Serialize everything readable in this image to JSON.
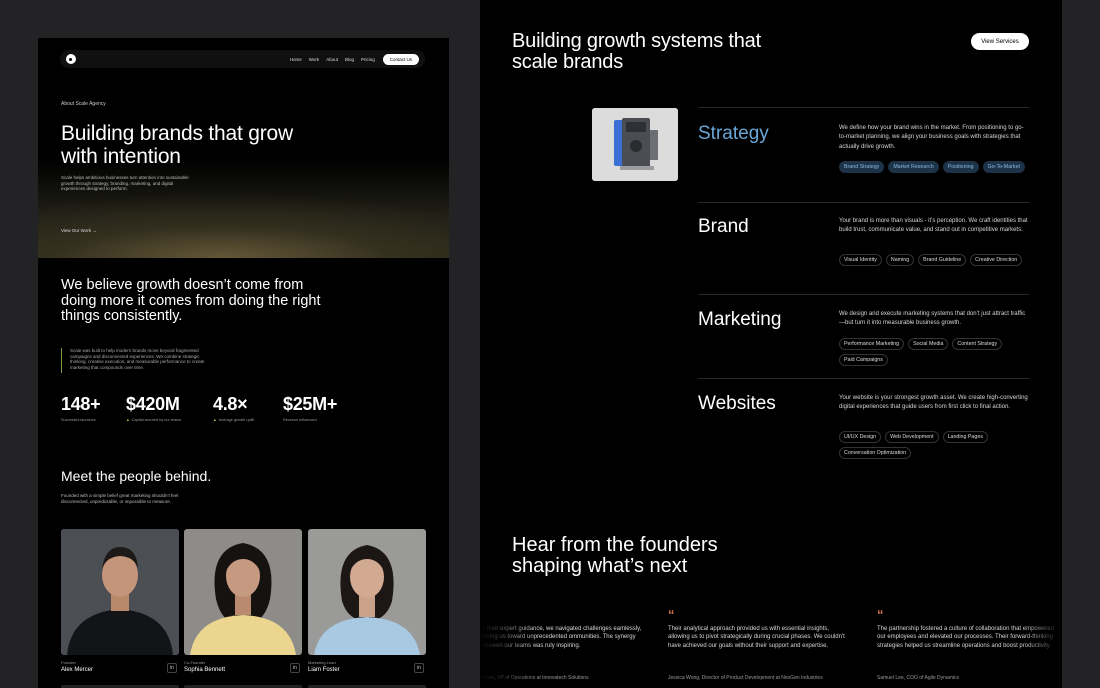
{
  "left": {
    "nav": {
      "links": [
        "Home",
        "Work",
        "About",
        "Blog",
        "Pricing"
      ],
      "cta": "Contact Us"
    },
    "hero": {
      "eyebrow": "About Scale Agency",
      "title": "Building brands that grow with intention",
      "subtitle": "Scale helps ambitious businesses turn attention into sustainable growth through strategy, branding, marketing, and digital experiences designed to perform.",
      "link": "View Our Work →"
    },
    "belief": "We believe growth doesn’t come from doing more it comes from doing the right things consistently.",
    "quote": "Scale was built to help modern brands move beyond fragmented campaigns and disconnected experiences. We combine strategic thinking, creative execution, and measurable performance to create marketing that compounds over time.",
    "stats": [
      {
        "value": "148+",
        "label": "Successful launches",
        "up": false
      },
      {
        "value": "$420M",
        "label": "Capital secured by our teams",
        "up": true
      },
      {
        "value": "4.8×",
        "label": "Average growth uplift",
        "up": true
      },
      {
        "value": "$25M+",
        "label": "Revenue influenced",
        "up": false
      }
    ],
    "team": {
      "title": "Meet the people behind.",
      "subtitle": "Founded with a simple belief great marketing shouldn’t feel disconnected, unpredictable, or impossible to measure.",
      "members": [
        {
          "role": "Founder",
          "name": "Alex Mercer",
          "icon": "linkedin-icon"
        },
        {
          "role": "Co-Founder",
          "name": "Sophia Bennett",
          "icon": "linkedin-icon"
        },
        {
          "role": "Marketing Lead",
          "name": "Liam Foster",
          "icon": "linkedin-icon"
        }
      ]
    }
  },
  "right": {
    "title": "Building growth systems that scale brands",
    "view_button": "View Services",
    "services": [
      {
        "name": "Strategy",
        "active": true,
        "desc": "We define how your brand wins in the market. From positioning to go-to-market planning, we align your business goals with strategies that actually drive growth.",
        "tags": [
          "Brand Strategy",
          "Market Research",
          "Positioning",
          "Go-To-Market"
        ]
      },
      {
        "name": "Brand",
        "active": false,
        "desc": "Your brand is more than visuals - it’s perception. We craft identities that build trust, communicate value, and stand out in competitive markets.",
        "tags": [
          "Visual Identity",
          "Naming",
          "Brand Guideline",
          "Creative Direction"
        ]
      },
      {
        "name": "Marketing",
        "active": false,
        "desc": "We design and execute marketing systems that don’t just attract traffic—but turn it into measurable business growth.",
        "tags": [
          "Performance Marketing",
          "Social Media",
          "Content Strategy",
          "Paid Campaigns"
        ]
      },
      {
        "name": "Websites",
        "active": false,
        "desc": "Your website is your strongest growth asset. We create high-converting digital experiences that guide users from first click to final action.",
        "tags": [
          "UI/UX Design",
          "Web Development",
          "Landing Pages",
          "Conversation Optimization"
        ]
      }
    ],
    "testimonials_title": "Hear from the founders shaping what’s next",
    "testimonials": [
      {
        "text": "th their expert guidance, we navigated challenges eamlessly, driving us toward unprecedented ommunities. The synergy between our teams was ruly inspiring.",
        "author": "- Patel, VP of Operations at Innovatech Solutions"
      },
      {
        "text": "Their analytical approach provided us with essential insights, allowing us to pivot strategically during crucial phases. We couldn't have achieved our goals without their support and expertise.",
        "author": "Jessica Wong, Director of Product Development at NexGen Industries"
      },
      {
        "text": "The partnership fostered a culture of collaboration that empowered our employees and elevated our processes. Their forward-thinking strategies helped us streamline operations and boost productivity.",
        "author": "Samuel Lee, COO of Agile Dynamics"
      }
    ]
  }
}
